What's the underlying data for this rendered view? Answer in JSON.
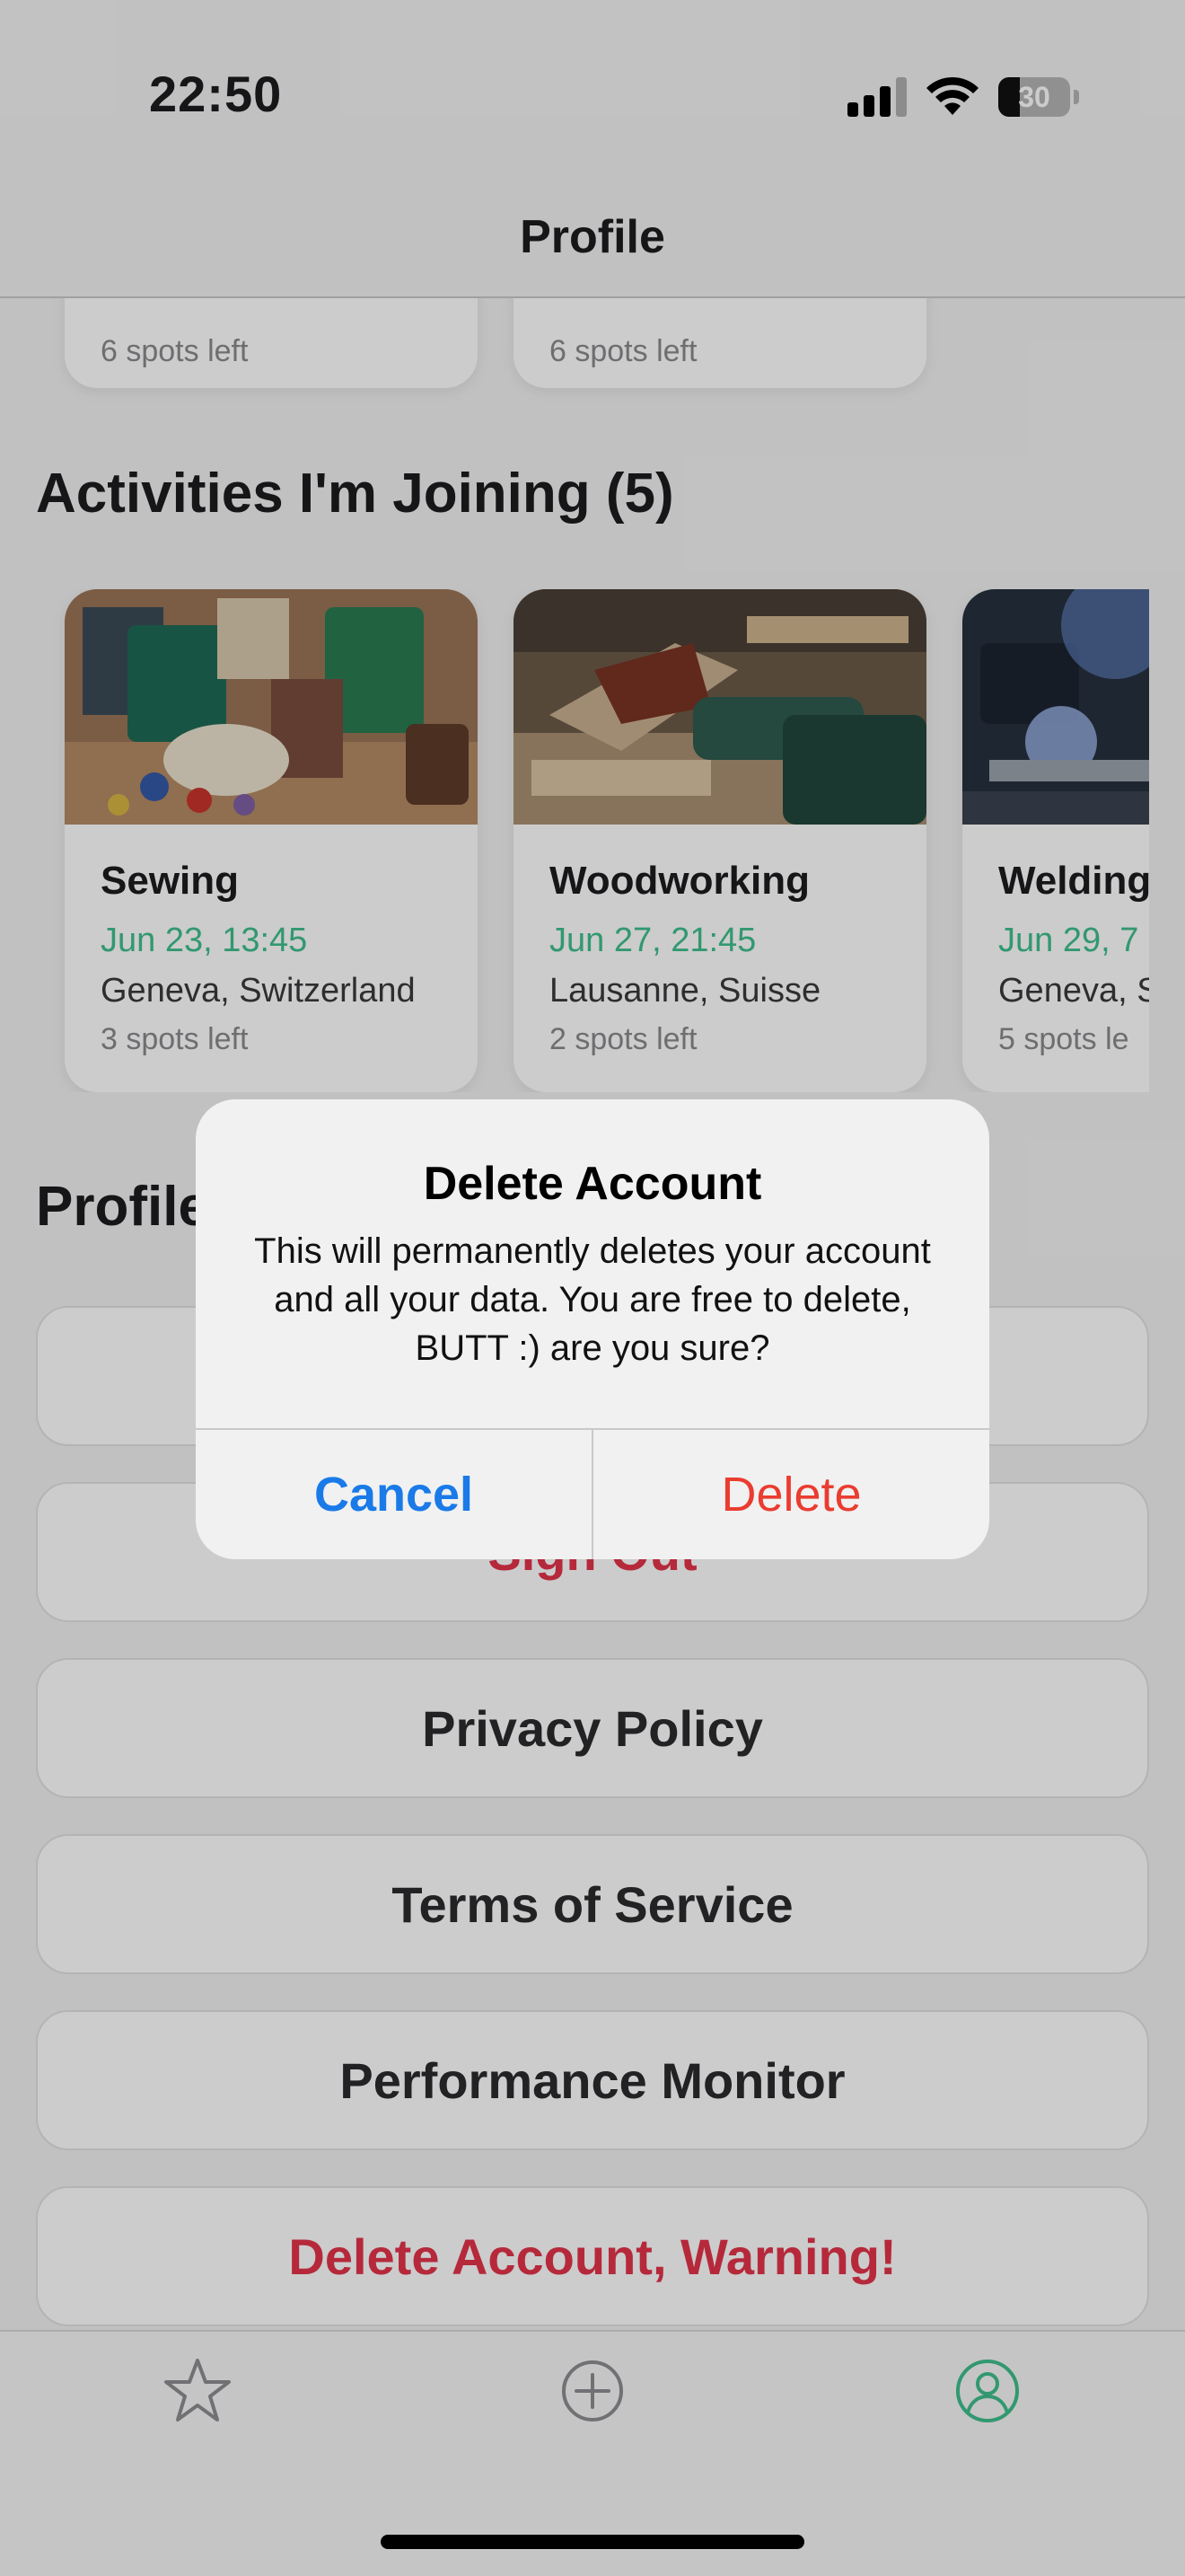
{
  "status_bar": {
    "time": "22:50",
    "battery": "30",
    "battery_level": 0.3
  },
  "nav": {
    "title": "Profile"
  },
  "previous_row": [
    {
      "spots": "6 spots left"
    },
    {
      "spots": "6 spots left"
    }
  ],
  "joining": {
    "title": "Activities I'm Joining (5)",
    "cards": [
      {
        "name": "Sewing",
        "date": "Jun 23, 13:45",
        "location": "Geneva, Switzerland",
        "spots": "3 spots left"
      },
      {
        "name": "Woodworking",
        "date": "Jun 27, 21:45",
        "location": "Lausanne, Suisse",
        "spots": "2 spots left"
      },
      {
        "name": "Welding",
        "date": "Jun 29, 7",
        "location": "Geneva, S",
        "spots": "5 spots le"
      }
    ]
  },
  "profile": {
    "title": "Profile",
    "buttons": {
      "sign_out": "Sign Out",
      "privacy": "Privacy Policy",
      "terms": "Terms of Service",
      "performance": "Performance Monitor",
      "delete_account": "Delete Account, Warning!"
    }
  },
  "alert": {
    "title": "Delete Account",
    "message": "This will permanently deletes your account and all your data. You are free to delete, BUTT :) are you sure?",
    "cancel": "Cancel",
    "delete": "Delete"
  },
  "tabs": [
    {
      "icon": "star-icon"
    },
    {
      "icon": "plus-circle-icon"
    },
    {
      "icon": "person-circle-icon",
      "active": true
    }
  ],
  "colors": {
    "accent": "#3fbf8c",
    "danger": "#e3344a",
    "alert_cancel": "#1a7ae8",
    "alert_delete": "#ea3c30"
  }
}
